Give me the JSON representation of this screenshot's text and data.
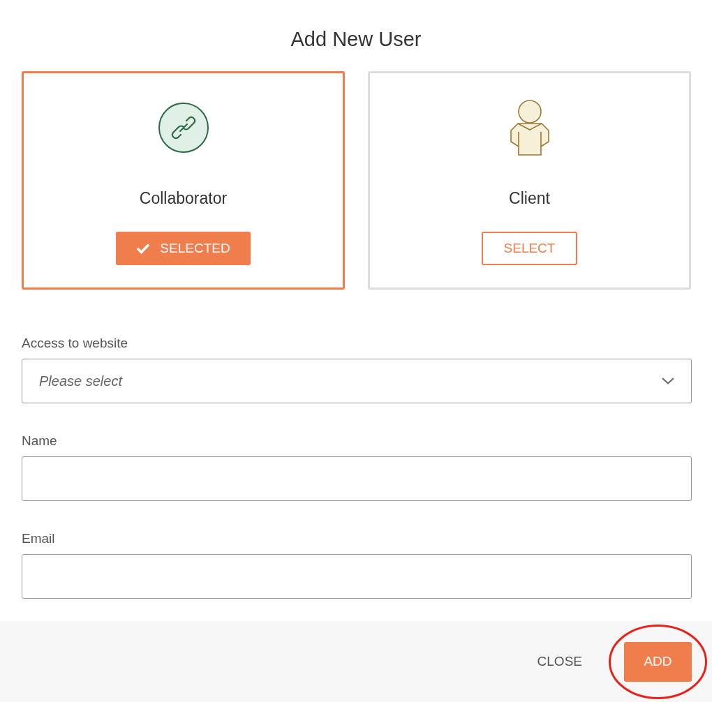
{
  "dialog": {
    "title": "Add New User"
  },
  "user_types": [
    {
      "kind": "link",
      "label": "Collaborator",
      "button": "SELECTED",
      "selected": true
    },
    {
      "kind": "person",
      "label": "Client",
      "button": "SELECT",
      "selected": false
    }
  ],
  "fields": [
    {
      "kind": "select",
      "label": "Access to website",
      "placeholder": "Please select"
    },
    {
      "kind": "text",
      "label": "Name"
    },
    {
      "kind": "text",
      "label": "Email"
    }
  ],
  "footer": {
    "buttons": [
      {
        "kind": "text",
        "label": "CLOSE"
      },
      {
        "kind": "primary",
        "label": "ADD",
        "annotation": {
          "kind": "ellipse"
        }
      }
    ]
  }
}
